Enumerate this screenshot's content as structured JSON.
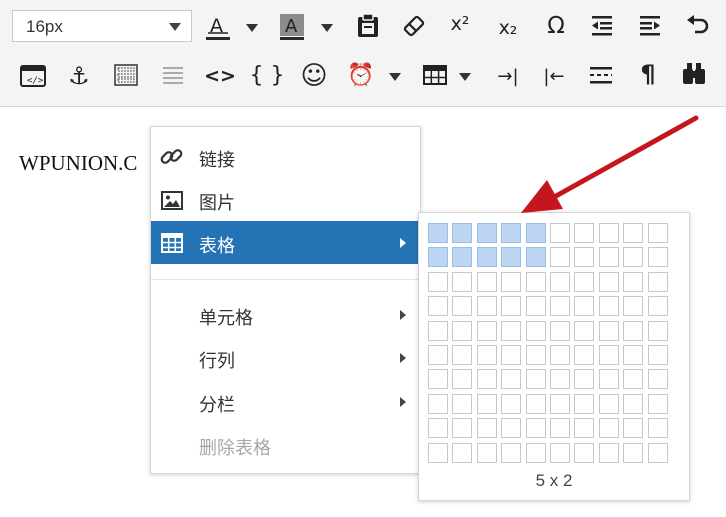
{
  "toolbar": {
    "font_size": {
      "value": "16px"
    },
    "row1": [
      {
        "name": "font-color-icon",
        "glyph": "A"
      },
      {
        "name": "background-color-icon",
        "glyph": "A"
      },
      {
        "name": "paste-icon"
      },
      {
        "name": "eraser-icon"
      },
      {
        "name": "superscript-icon",
        "glyph": "x²"
      },
      {
        "name": "subscript-icon",
        "glyph": "x₂"
      },
      {
        "name": "omega-icon",
        "glyph": "Ω"
      },
      {
        "name": "outdent-icon"
      },
      {
        "name": "indent-icon"
      },
      {
        "name": "undo-icon"
      }
    ],
    "row2": [
      {
        "name": "embed-icon"
      },
      {
        "name": "anchor-icon",
        "glyph": "⚓"
      },
      {
        "name": "template-icon"
      },
      {
        "name": "list-icon"
      },
      {
        "name": "code-icon",
        "glyph": "<>"
      },
      {
        "name": "braces-icon",
        "glyph": "{ }"
      },
      {
        "name": "emoticon-icon",
        "glyph": "☺"
      },
      {
        "name": "alarm-icon",
        "glyph": "⏰"
      },
      {
        "name": "table-icon"
      },
      {
        "name": "tab-right-icon",
        "glyph": "→|"
      },
      {
        "name": "tab-left-icon",
        "glyph": "|←"
      },
      {
        "name": "page-break-icon"
      },
      {
        "name": "pilcrow-icon",
        "glyph": "¶"
      },
      {
        "name": "binoculars-icon"
      }
    ]
  },
  "content": {
    "text": "WPUNION.C"
  },
  "context_menu": {
    "items": [
      {
        "label": "链接",
        "icon": "link-icon"
      },
      {
        "label": "图片",
        "icon": "image-icon"
      },
      {
        "label": "表格",
        "icon": "table-icon",
        "active": true
      },
      {
        "label": "单元格"
      },
      {
        "label": "行列"
      },
      {
        "label": "分栏"
      },
      {
        "label": "删除表格",
        "disabled": true
      }
    ]
  },
  "table_grid": {
    "cols": 10,
    "rows": 10,
    "selected_cols": 5,
    "selected_rows": 2,
    "label": "5 x 2"
  },
  "colors": {
    "accent": "#2474b5",
    "selected_cell": "#bcd5f2",
    "annotation_arrow": "#c4161c"
  }
}
